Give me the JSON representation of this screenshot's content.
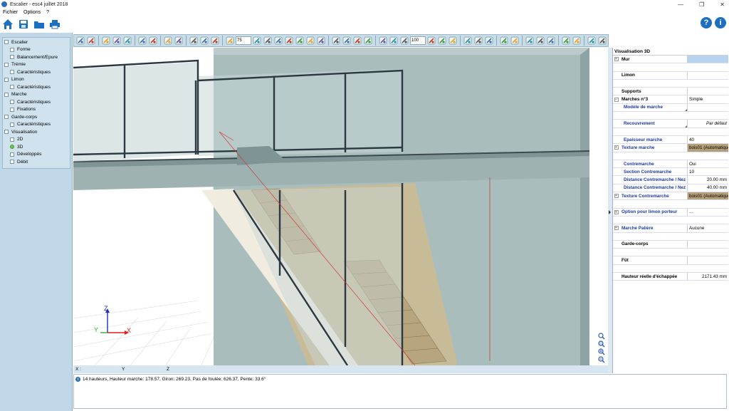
{
  "window": {
    "title": "Escalier - esc4 juillet 2018",
    "controls": {
      "minimize": "—",
      "maximize": "❐",
      "close": "✕"
    }
  },
  "menu": [
    "Fichier",
    "Options",
    "?"
  ],
  "quickbar": {
    "icons": [
      "home-icon",
      "save-icon",
      "folder-icon",
      "print-icon"
    ],
    "help_label": "?",
    "info_label": "i",
    "help_color": "#1e6fbf",
    "info_color": "#1e6fbf"
  },
  "tree": [
    {
      "label": "Escalier",
      "level": 0
    },
    {
      "label": "Forme",
      "level": 1
    },
    {
      "label": "Balancement/Epure",
      "level": 1
    },
    {
      "label": "Trémie",
      "level": 0
    },
    {
      "label": "Caractéristiques",
      "level": 1
    },
    {
      "label": "Limon",
      "level": 0
    },
    {
      "label": "Caractéristiques",
      "level": 1
    },
    {
      "label": "Marche",
      "level": 0
    },
    {
      "label": "Caractéristiques",
      "level": 1
    },
    {
      "label": "Fixations",
      "level": 1
    },
    {
      "label": "Garde-corps",
      "level": 0
    },
    {
      "label": "Caractéristiques",
      "level": 1
    },
    {
      "label": "Visualisation",
      "level": 0
    },
    {
      "label": "2D",
      "level": 1
    },
    {
      "label": "3D",
      "level": 1,
      "active": true
    },
    {
      "label": "Développés",
      "level": 1
    },
    {
      "label": "Débit",
      "level": 1
    }
  ],
  "toolbar": {
    "input1": "75",
    "input2": "100"
  },
  "viewport": {
    "axis_z": "Z",
    "axis_y": "Y",
    "axis_x": "X"
  },
  "coords": {
    "x": "X :",
    "y": "Y",
    "z": "Z"
  },
  "status": {
    "message": "14 hauteurs, Hauteur marche: 178.57, Giron: 269.23, Pas de foulée: 626.37, Pente: 33.6°"
  },
  "properties": {
    "title": "Visualisation 3D",
    "rows": [
      {
        "exp": "+",
        "label": "Mur",
        "value": "",
        "style": "sel"
      },
      {
        "blank": true
      },
      {
        "label": "Limon",
        "value": ""
      },
      {
        "blank": true
      },
      {
        "label": "Supports",
        "value": ""
      },
      {
        "exp": "−",
        "label": "Marches n°3",
        "value": "Simple"
      },
      {
        "label": "Modèle de marche",
        "value": "",
        "blue": true,
        "indent": true,
        "corner": true
      },
      {
        "blank": true
      },
      {
        "label": "Recouvrement",
        "value": "Par défaut",
        "blue": true,
        "indent": true,
        "corner": true,
        "italic": true,
        "right": true
      },
      {
        "blank": true
      },
      {
        "label": "Epaisseur marche",
        "value": "40",
        "blue": true,
        "indent": true
      },
      {
        "exp": "+",
        "label": "Texture marche",
        "value": "bois01 (Automatique",
        "blue": true,
        "style": "tex"
      },
      {
        "blank": true
      },
      {
        "label": "Contremarche",
        "value": "Oui",
        "blue": true,
        "indent": true
      },
      {
        "label": "Section Contremarche",
        "value": "10",
        "blue": true,
        "indent": true
      },
      {
        "label": "Distance Contremarche / Nez",
        "value": "20.00 mm",
        "blue": true,
        "indent": true,
        "right": true
      },
      {
        "label": "Distance Contremarche / Nez",
        "value": "40.00 mm",
        "blue": true,
        "indent": true,
        "right": true
      },
      {
        "exp": "+",
        "label": "Texture Contremarche",
        "value": "bois01 (Automatique",
        "blue": true,
        "style": "tex"
      },
      {
        "blank": true
      },
      {
        "exp": "+",
        "label": "Option pour limon porteur",
        "value": "...",
        "blue": true
      },
      {
        "blank": true
      },
      {
        "exp": "+",
        "label": "Marche Palière",
        "value": "Aucune",
        "blue": true
      },
      {
        "blank": true
      },
      {
        "label": "Garde-corps",
        "value": ""
      },
      {
        "blank": true
      },
      {
        "label": "Fût",
        "value": ""
      },
      {
        "blank": true
      },
      {
        "label": "Hauteur réelle d'échappée",
        "value": "2171.43 mm",
        "right": true
      }
    ]
  }
}
